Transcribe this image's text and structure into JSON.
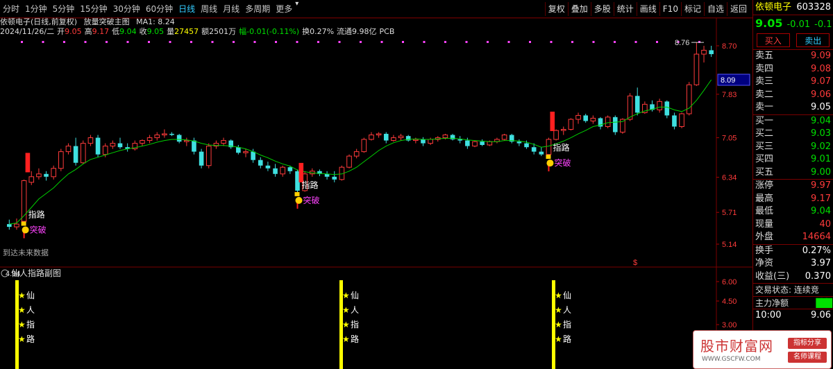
{
  "toolbar": {
    "periods": [
      "分时",
      "1分钟",
      "5分钟",
      "15分钟",
      "30分钟",
      "60分钟",
      "日线",
      "周线",
      "月线",
      "多周期",
      "更多"
    ],
    "active_period": "日线",
    "right_buttons": [
      "复权",
      "叠加",
      "多股",
      "统计",
      "画线",
      "F10",
      "标记",
      "自选",
      "返回"
    ]
  },
  "info": {
    "stock": "依顿电子(日线,前复权)",
    "indicator": "放量突破主图",
    "ma": "MA1: 8.24",
    "date": "2024/11/26/二",
    "open_label": "开",
    "open": "9.05",
    "high_label": "高",
    "high": "9.17",
    "low_label": "低",
    "low": "9.04",
    "close_label": "收",
    "close": "9.05",
    "vol_label": "量",
    "vol": "27457",
    "amount": "额2501万",
    "change": "幅-0.01(-0.11%)",
    "turnover": "换0.27%",
    "float": "流通9.98亿",
    "sector": "PCB"
  },
  "main_axis": [
    "8.70",
    "7.83",
    "7.05",
    "6.34",
    "5.71",
    "5.14"
  ],
  "current_price_tag": "8.09",
  "peak_label": "8.76",
  "low_label_chart": "4.94",
  "no_data_text": "到达未来数据",
  "signals": [
    {
      "top": "指路",
      "bottom": "突破"
    },
    {
      "top": "指路",
      "bottom": "突破"
    },
    {
      "top": "指路",
      "bottom": "突破"
    }
  ],
  "dollar_mark": "$",
  "sub": {
    "title": "仙人指路副图",
    "axis": [
      "6.00",
      "4.50",
      "3.00"
    ],
    "chars": [
      "仙",
      "人",
      "指",
      "路"
    ]
  },
  "side": {
    "name": "依顿电子",
    "code": "603328",
    "price": "9.05",
    "chg": "-0.01",
    "pct": "-0.11",
    "buy_btn": "买入",
    "sell_btn": "卖出",
    "asks": [
      {
        "label": "卖五",
        "price": "9.09"
      },
      {
        "label": "卖四",
        "price": "9.08"
      },
      {
        "label": "卖三",
        "price": "9.07"
      },
      {
        "label": "卖二",
        "price": "9.06"
      },
      {
        "label": "卖一",
        "price": "9.05"
      }
    ],
    "bids": [
      {
        "label": "买一",
        "price": "9.04"
      },
      {
        "label": "买二",
        "price": "9.03"
      },
      {
        "label": "买三",
        "price": "9.02"
      },
      {
        "label": "买四",
        "price": "9.01"
      },
      {
        "label": "买五",
        "price": "9.00"
      }
    ],
    "stats": [
      {
        "label": "涨停",
        "value": "9.97",
        "color": "red"
      },
      {
        "label": "最高",
        "value": "9.17",
        "color": "red"
      },
      {
        "label": "最低",
        "value": "9.04",
        "color": "green"
      },
      {
        "label": "现量",
        "value": "40",
        "color": "red"
      },
      {
        "label": "外盘",
        "value": "14664",
        "color": "red"
      }
    ],
    "stats2": [
      {
        "label": "换手",
        "value": "0.27%",
        "color": "white"
      },
      {
        "label": "净资",
        "value": "3.97",
        "color": "white"
      },
      {
        "label": "收益(三)",
        "value": "0.370",
        "color": "white"
      }
    ],
    "trade_status": "交易状态: 连续竞",
    "main_net": "主力净额",
    "time": "10:00",
    "time_price": "9.06"
  },
  "ad": {
    "title": "股市财富网",
    "url": "WWW.GSCFW.COM",
    "tag1": "指标分享",
    "tag2": "名师课程"
  },
  "colors": {
    "up": "#ff3b3b",
    "down": "#3fe0e0",
    "ma": "#00d000",
    "signal": "#ffff00",
    "magenta": "#ff44ff"
  },
  "chart_data": {
    "type": "candlestick",
    "ylim": [
      4.94,
      8.76
    ],
    "candles": [
      [
        5.5,
        5.58,
        5.4,
        5.45
      ],
      [
        5.45,
        5.6,
        5.4,
        5.5
      ],
      [
        5.55,
        6.3,
        5.52,
        6.28
      ],
      [
        6.25,
        6.45,
        6.2,
        6.35
      ],
      [
        6.35,
        6.5,
        6.3,
        6.4
      ],
      [
        6.4,
        6.45,
        6.28,
        6.35
      ],
      [
        6.35,
        6.55,
        6.3,
        6.5
      ],
      [
        6.5,
        6.85,
        6.45,
        6.8
      ],
      [
        6.8,
        6.95,
        6.75,
        6.9
      ],
      [
        6.9,
        7.05,
        6.55,
        6.6
      ],
      [
        6.6,
        7.0,
        6.58,
        6.95
      ],
      [
        6.95,
        7.1,
        6.9,
        7.05
      ],
      [
        7.05,
        7.1,
        6.7,
        6.75
      ],
      [
        6.75,
        6.95,
        6.7,
        6.9
      ],
      [
        6.9,
        7.0,
        6.85,
        6.95
      ],
      [
        6.95,
        7.05,
        6.85,
        6.88
      ],
      [
        6.88,
        6.95,
        6.8,
        6.85
      ],
      [
        6.85,
        7.0,
        6.82,
        6.95
      ],
      [
        6.95,
        7.02,
        6.9,
        7.0
      ],
      [
        7.0,
        7.1,
        6.95,
        7.05
      ],
      [
        7.05,
        7.15,
        7.0,
        7.1
      ],
      [
        7.1,
        7.2,
        7.05,
        7.12
      ],
      [
        7.12,
        7.15,
        7.08,
        7.1
      ],
      [
        7.1,
        7.12,
        6.95,
        6.98
      ],
      [
        6.98,
        7.05,
        6.9,
        7.0
      ],
      [
        7.0,
        7.05,
        6.75,
        6.8
      ],
      [
        6.8,
        6.85,
        6.5,
        6.55
      ],
      [
        6.55,
        6.95,
        6.5,
        6.9
      ],
      [
        6.9,
        7.0,
        6.85,
        6.95
      ],
      [
        6.95,
        7.05,
        6.9,
        7.0
      ],
      [
        7.0,
        7.02,
        6.85,
        6.88
      ],
      [
        6.88,
        6.92,
        6.75,
        6.78
      ],
      [
        6.78,
        6.85,
        6.7,
        6.8
      ],
      [
        6.8,
        6.85,
        6.6,
        6.65
      ],
      [
        6.65,
        6.7,
        6.5,
        6.55
      ],
      [
        6.55,
        6.62,
        6.45,
        6.5
      ],
      [
        6.5,
        6.58,
        6.35,
        6.4
      ],
      [
        6.4,
        6.55,
        6.35,
        6.52
      ],
      [
        6.52,
        6.55,
        6.4,
        6.45
      ],
      [
        6.45,
        6.48,
        6.05,
        6.1
      ],
      [
        6.1,
        6.45,
        6.08,
        6.4
      ],
      [
        6.4,
        6.5,
        6.35,
        6.45
      ],
      [
        6.45,
        6.48,
        6.36,
        6.4
      ],
      [
        6.4,
        6.45,
        6.3,
        6.35
      ],
      [
        6.35,
        6.45,
        6.25,
        6.3
      ],
      [
        6.3,
        6.55,
        6.28,
        6.52
      ],
      [
        6.52,
        6.75,
        6.5,
        6.72
      ],
      [
        6.72,
        6.85,
        6.68,
        6.8
      ],
      [
        6.8,
        7.05,
        6.78,
        7.02
      ],
      [
        7.02,
        7.15,
        7.0,
        7.1
      ],
      [
        7.1,
        7.15,
        7.05,
        7.12
      ],
      [
        7.12,
        7.15,
        6.95,
        7.0
      ],
      [
        7.0,
        7.1,
        6.98,
        7.05
      ],
      [
        7.05,
        7.12,
        7.0,
        7.08
      ],
      [
        7.08,
        7.1,
        6.98,
        7.0
      ],
      [
        7.0,
        7.05,
        6.95,
        7.02
      ],
      [
        7.02,
        7.06,
        6.9,
        6.95
      ],
      [
        6.95,
        7.05,
        6.92,
        7.02
      ],
      [
        7.02,
        7.08,
        6.98,
        7.05
      ],
      [
        7.05,
        7.12,
        7.02,
        7.1
      ],
      [
        7.1,
        7.12,
        7.0,
        7.02
      ],
      [
        7.02,
        7.08,
        6.95,
        7.0
      ],
      [
        7.0,
        7.05,
        6.85,
        6.9
      ],
      [
        6.9,
        7.0,
        6.88,
        6.98
      ],
      [
        6.98,
        7.02,
        6.9,
        6.92
      ],
      [
        6.92,
        7.0,
        6.9,
        6.98
      ],
      [
        6.98,
        7.05,
        6.95,
        7.02
      ],
      [
        7.02,
        7.12,
        7.0,
        7.1
      ],
      [
        7.1,
        7.12,
        6.95,
        6.98
      ],
      [
        6.98,
        7.02,
        6.9,
        6.95
      ],
      [
        6.95,
        7.0,
        6.85,
        6.88
      ],
      [
        6.88,
        6.95,
        6.75,
        6.8
      ],
      [
        6.8,
        6.88,
        6.72,
        6.75
      ],
      [
        6.75,
        7.05,
        6.72,
        7.02
      ],
      [
        7.02,
        7.2,
        7.0,
        7.18
      ],
      [
        7.18,
        7.25,
        7.1,
        7.2
      ],
      [
        7.2,
        7.4,
        7.18,
        7.38
      ],
      [
        7.38,
        7.5,
        7.3,
        7.45
      ],
      [
        7.45,
        7.48,
        7.32,
        7.35
      ],
      [
        7.35,
        7.45,
        7.3,
        7.4
      ],
      [
        7.4,
        7.42,
        7.2,
        7.25
      ],
      [
        7.25,
        7.45,
        7.22,
        7.42
      ],
      [
        7.42,
        7.45,
        7.1,
        7.15
      ],
      [
        7.15,
        7.4,
        7.12,
        7.38
      ],
      [
        7.38,
        7.85,
        7.35,
        7.8
      ],
      [
        7.8,
        7.95,
        7.45,
        7.5
      ],
      [
        7.5,
        7.7,
        7.48,
        7.65
      ],
      [
        7.65,
        7.72,
        7.52,
        7.55
      ],
      [
        7.55,
        7.75,
        7.5,
        7.7
      ],
      [
        7.7,
        7.72,
        7.4,
        7.45
      ],
      [
        7.45,
        7.5,
        7.2,
        7.25
      ],
      [
        7.25,
        7.5,
        7.22,
        7.48
      ],
      [
        7.48,
        8.05,
        7.45,
        8.0
      ],
      [
        8.0,
        8.76,
        7.98,
        8.55
      ],
      [
        8.55,
        8.7,
        8.4,
        8.62
      ],
      [
        8.62,
        8.7,
        8.5,
        8.55
      ]
    ],
    "ma_values": [
      5.5,
      5.52,
      5.65,
      5.8,
      5.95,
      6.05,
      6.15,
      6.28,
      6.4,
      6.48,
      6.58,
      6.66,
      6.7,
      6.74,
      6.78,
      6.82,
      6.85,
      6.87,
      6.9,
      6.93,
      6.97,
      7.0,
      7.02,
      7.02,
      7.01,
      6.99,
      6.95,
      6.92,
      6.91,
      6.91,
      6.9,
      6.88,
      6.85,
      6.8,
      6.74,
      6.69,
      6.63,
      6.58,
      6.54,
      6.47,
      6.44,
      6.42,
      6.41,
      6.4,
      6.39,
      6.4,
      6.45,
      6.52,
      6.62,
      6.72,
      6.82,
      6.9,
      6.96,
      7.0,
      7.02,
      7.03,
      7.02,
      7.02,
      7.03,
      7.04,
      7.04,
      7.03,
      7.01,
      7.0,
      6.99,
      6.98,
      6.98,
      7.0,
      7.0,
      6.99,
      6.97,
      6.93,
      6.88,
      6.9,
      6.94,
      6.99,
      7.05,
      7.12,
      7.18,
      7.25,
      7.28,
      7.32,
      7.33,
      7.34,
      7.42,
      7.48,
      7.53,
      7.56,
      7.6,
      7.6,
      7.55,
      7.52,
      7.58,
      7.72,
      7.9,
      8.09
    ],
    "signal_indices": [
      2,
      39,
      73
    ]
  }
}
